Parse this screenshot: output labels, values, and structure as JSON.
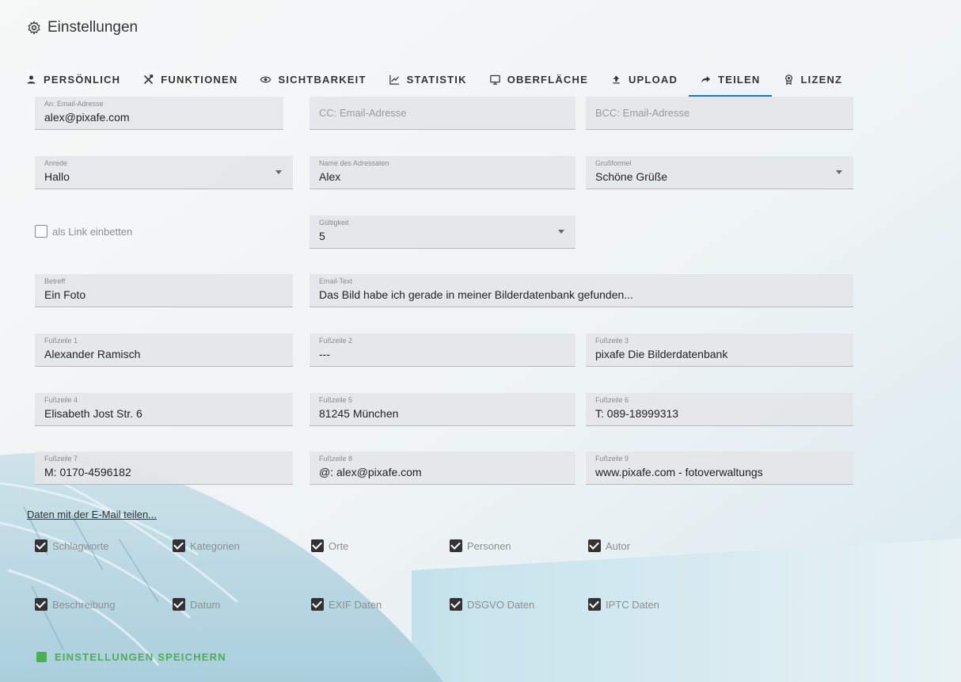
{
  "app": {
    "title": "Einstellungen",
    "title_icon": "gear-icon"
  },
  "tabs": [
    {
      "label": "PERSÖNLICH",
      "icon": "person-icon",
      "active": false
    },
    {
      "label": "FUNKTIONEN",
      "icon": "tools-icon",
      "active": false
    },
    {
      "label": "SICHTBARKEIT",
      "icon": "eye-icon",
      "active": false
    },
    {
      "label": "STATISTIK",
      "icon": "chart-line-icon",
      "active": false
    },
    {
      "label": "OBERFLÄCHE",
      "icon": "monitor-icon",
      "active": false
    },
    {
      "label": "UPLOAD",
      "icon": "upload-icon",
      "active": false
    },
    {
      "label": "TEILEN",
      "icon": "share-icon",
      "active": true
    },
    {
      "label": "LIZENZ",
      "icon": "certificate-icon",
      "active": false
    }
  ],
  "form": {
    "to": {
      "label": "An: Email-Adresse",
      "value": "alex@pixafe.com"
    },
    "cc": {
      "placeholder": "CC: Email-Adresse"
    },
    "bcc": {
      "placeholder": "BCC: Email-Adresse"
    },
    "salutation": {
      "label": "Anrede",
      "value": "Hallo"
    },
    "recipient_name": {
      "label": "Name des Adressaten",
      "value": "Alex"
    },
    "closing": {
      "label": "Grußformel",
      "value": "Schöne Grüße"
    },
    "embed_link": {
      "label": "als Link einbetten",
      "checked": false
    },
    "validity": {
      "label": "Gültigkeit",
      "value": "5"
    },
    "subject": {
      "label": "Betreff",
      "value": "Ein Foto"
    },
    "email_text": {
      "label": "Email-Text",
      "value": "Das Bild habe ich gerade in meiner Bilderdatenbank gefunden..."
    },
    "footers": [
      {
        "label": "Fußzeile 1",
        "value": "Alexander Ramisch"
      },
      {
        "label": "Fußzeile 2",
        "value": "---"
      },
      {
        "label": "Fußzeile 3",
        "value": "pixafe Die Bilderdatenbank"
      },
      {
        "label": "Fußzeile 4",
        "value": "Elisabeth Jost Str. 6"
      },
      {
        "label": "Fußzeile 5",
        "value": "81245 München"
      },
      {
        "label": "Fußzeile 6",
        "value": "T: 089-18999313"
      },
      {
        "label": "Fußzeile 7",
        "value": "M: 0170-4596182"
      },
      {
        "label": "Fußzeile 8",
        "value": "@: alex@pixafe.com"
      },
      {
        "label": "Fußzeile 9",
        "value": "www.pixafe.com - fotoverwaltungs"
      }
    ]
  },
  "share_data": {
    "link_label": "Daten mit der E-Mail teilen...",
    "items": [
      {
        "label": "Schlagworte",
        "checked": true
      },
      {
        "label": "Kategorien",
        "checked": true
      },
      {
        "label": "Orte",
        "checked": true
      },
      {
        "label": "Personen",
        "checked": true
      },
      {
        "label": "Autor",
        "checked": true
      },
      {
        "label": "Beschreibung",
        "checked": true
      },
      {
        "label": "Datum",
        "checked": true
      },
      {
        "label": "EXIF Daten",
        "checked": true
      },
      {
        "label": "DSGVO Daten",
        "checked": true
      },
      {
        "label": "IPTC Daten",
        "checked": true
      }
    ]
  },
  "save_button": {
    "label": "EINSTELLUNGEN SPEICHERN",
    "color": "#4caf50"
  },
  "colors": {
    "accent": "#1976d2",
    "field_bg": "#e4e6e8"
  }
}
